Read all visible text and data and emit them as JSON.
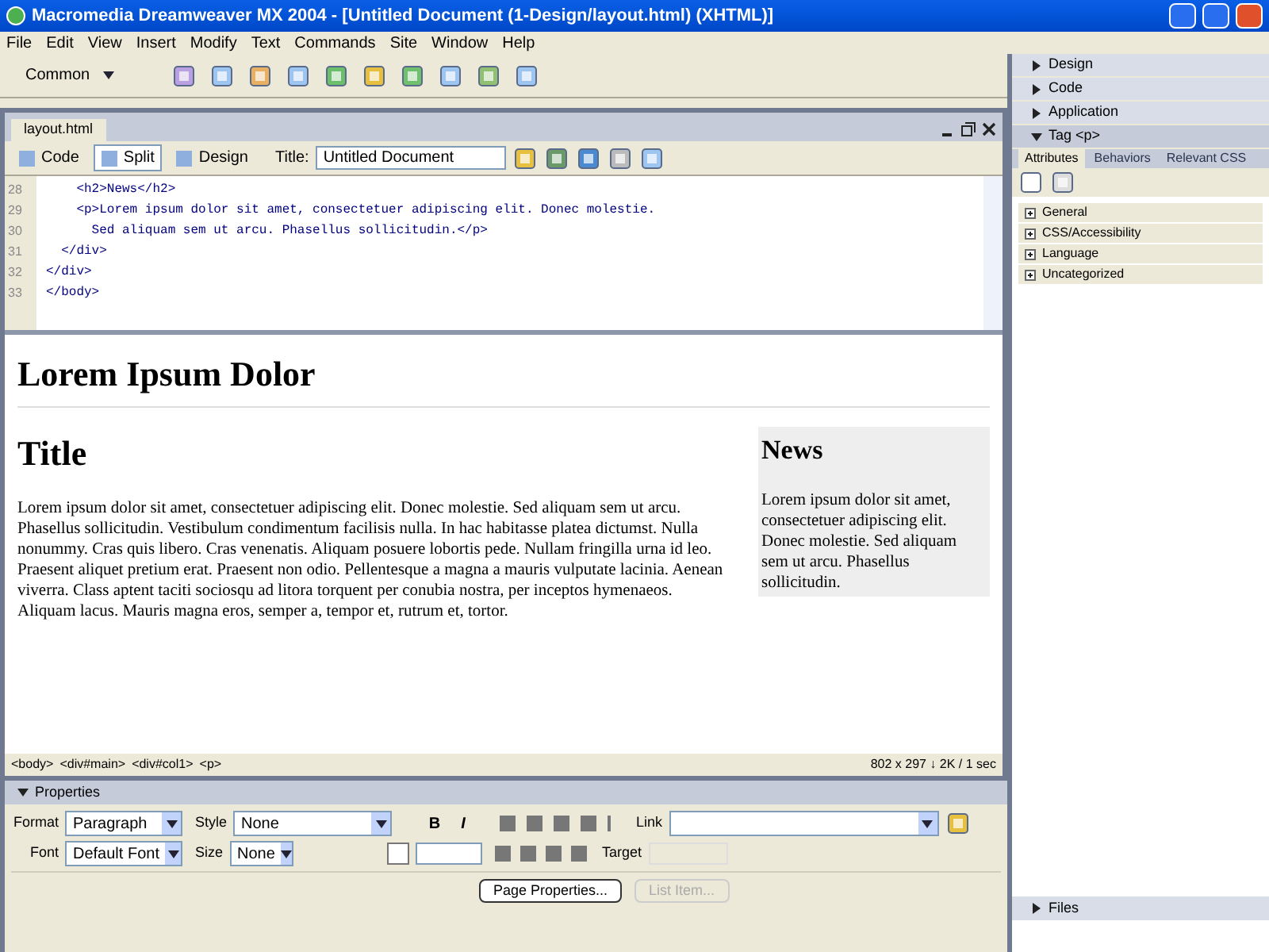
{
  "window": {
    "title": "Macromedia Dreamweaver MX 2004 - [Untitled Document (1-Design/layout.html) (XHTML)]"
  },
  "menu": [
    "File",
    "Edit",
    "View",
    "Insert",
    "Modify",
    "Text",
    "Commands",
    "Site",
    "Window",
    "Help"
  ],
  "insert_bar": {
    "category": "Common"
  },
  "document": {
    "tab": "layout.html",
    "view_buttons": [
      {
        "label": "Code",
        "selected": false
      },
      {
        "label": "Split",
        "selected": true
      },
      {
        "label": "Design",
        "selected": false
      }
    ],
    "title_label": "Title:",
    "title_value": "Untitled Document",
    "code_lines": [
      {
        "number": "28",
        "text": "    <h2>News</h2>"
      },
      {
        "number": "29",
        "text": "    <p>Lorem ipsum dolor sit amet, consectetuer adipiscing elit. Donec molestie."
      },
      {
        "number": "30",
        "text": "      Sed aliquam sem ut arcu. Phasellus sollicitudin.</p>"
      },
      {
        "number": "31",
        "text": "  </div>"
      },
      {
        "number": "32",
        "text": "</div>"
      },
      {
        "number": "33",
        "text": "</body>"
      }
    ],
    "design": {
      "heading": "Lorem Ipsum Dolor",
      "title": "Title",
      "paragraph": "Lorem ipsum dolor sit amet, consectetuer adipiscing elit. Donec molestie. Sed aliquam sem ut arcu. Phasellus sollicitudin. Vestibulum condimentum facilisis nulla. In hac habitasse platea dictumst. Nulla nonummy. Cras quis libero. Cras venenatis. Aliquam posuere lobortis pede. Nullam fringilla urna id leo. Praesent aliquet pretium erat. Praesent non odio. Pellentesque a magna a mauris vulputate lacinia. Aenean viverra. Class aptent taciti sociosqu ad litora torquent per conubia nostra, per inceptos hymenaeos. Aliquam lacus. Mauris magna eros, semper a, tempor et, rutrum et, tortor.",
      "news_heading": "News",
      "news_text": "Lorem ipsum dolor sit amet, consectetuer adipiscing elit. Donec molestie. Sed aliquam sem ut arcu. Phasellus sollicitudin."
    },
    "tag_selector": [
      "<body>",
      "<div#main>",
      "<div#col1>",
      "<p>"
    ],
    "status": "802 x 297 ↓ 2K / 1 sec"
  },
  "properties": {
    "title": "Properties",
    "expanded": true,
    "format_label": "Format",
    "format_value": "Paragraph",
    "style_label": "Style",
    "style_value": "None",
    "font_label": "Font",
    "font_value": "Default Font",
    "size_label": "Size",
    "size_value": "None",
    "link_label": "Link",
    "format_buttons": [
      {
        "label": "B",
        "kind": "bold"
      },
      {
        "label": "I",
        "kind": "italic"
      }
    ],
    "target_label": "Target",
    "buttons": [
      {
        "label": "Page Properties...",
        "disabled": false
      },
      {
        "label": "List Item...",
        "disabled": true
      }
    ]
  },
  "panels": [
    {
      "label": "Design",
      "expanded": false
    },
    {
      "label": "Code",
      "expanded": false
    },
    {
      "label": "Application",
      "expanded": false
    },
    {
      "label": "Tag <p>",
      "expanded": true
    }
  ],
  "tag_tabs": [
    {
      "label": "Attributes",
      "selected": true
    },
    {
      "label": "Behaviors",
      "selected": false
    },
    {
      "label": "Relevant CSS",
      "selected": false
    }
  ],
  "categories": [
    "General",
    "CSS/Accessibility",
    "Language",
    "Uncategorized"
  ],
  "files_panel": {
    "label": "Files",
    "expanded": false
  }
}
